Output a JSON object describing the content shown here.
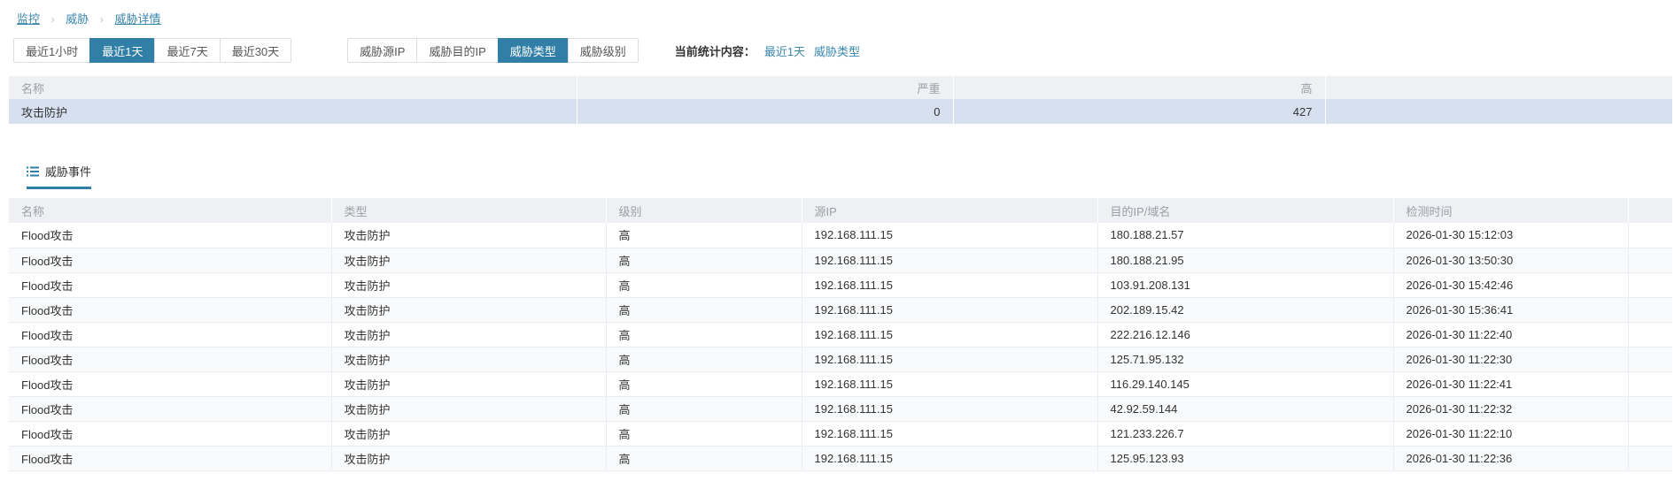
{
  "colors": {
    "accent": "#317ea7",
    "link": "#3a87ad",
    "header_bg": "#eef0f4",
    "selected_row_bg": "#d7e0ef",
    "stripe_bg": "#f9fafb",
    "border": "#ebedf0"
  },
  "breadcrumb": {
    "separator": "›",
    "items": [
      "监控",
      "威胁",
      "威胁详情"
    ]
  },
  "toolbar": {
    "time_filters": [
      "最近1小时",
      "最近1天",
      "最近7天",
      "最近30天"
    ],
    "time_selected_index": 1,
    "type_filters": [
      "威胁源IP",
      "威胁目的IP",
      "威胁类型",
      "威胁级别"
    ],
    "type_selected_index": 2,
    "summary_label": "当前统计内容：",
    "summary_links": [
      "最近1天",
      "威胁类型"
    ]
  },
  "summary_table": {
    "columns": [
      "名称",
      "严重",
      "高",
      ""
    ],
    "rows": [
      [
        "攻击防护",
        "0",
        "427",
        ""
      ]
    ]
  },
  "events": {
    "tab_label": "威胁事件",
    "columns": [
      "名称",
      "类型",
      "级别",
      "源IP",
      "目的IP/域名",
      "检测时间"
    ],
    "rows": [
      [
        "Flood攻击",
        "攻击防护",
        "高",
        "192.168.111.15",
        "180.188.21.57",
        "2026-01-30 15:12:03"
      ],
      [
        "Flood攻击",
        "攻击防护",
        "高",
        "192.168.111.15",
        "180.188.21.95",
        "2026-01-30 13:50:30"
      ],
      [
        "Flood攻击",
        "攻击防护",
        "高",
        "192.168.111.15",
        "103.91.208.131",
        "2026-01-30 15:42:46"
      ],
      [
        "Flood攻击",
        "攻击防护",
        "高",
        "192.168.111.15",
        "202.189.15.42",
        "2026-01-30 15:36:41"
      ],
      [
        "Flood攻击",
        "攻击防护",
        "高",
        "192.168.111.15",
        "222.216.12.146",
        "2026-01-30 11:22:40"
      ],
      [
        "Flood攻击",
        "攻击防护",
        "高",
        "192.168.111.15",
        "125.71.95.132",
        "2026-01-30 11:22:30"
      ],
      [
        "Flood攻击",
        "攻击防护",
        "高",
        "192.168.111.15",
        "116.29.140.145",
        "2026-01-30 11:22:41"
      ],
      [
        "Flood攻击",
        "攻击防护",
        "高",
        "192.168.111.15",
        "42.92.59.144",
        "2026-01-30 11:22:32"
      ],
      [
        "Flood攻击",
        "攻击防护",
        "高",
        "192.168.111.15",
        "121.233.226.7",
        "2026-01-30 11:22:10"
      ],
      [
        "Flood攻击",
        "攻击防护",
        "高",
        "192.168.111.15",
        "125.95.123.93",
        "2026-01-30 11:22:36"
      ]
    ]
  }
}
